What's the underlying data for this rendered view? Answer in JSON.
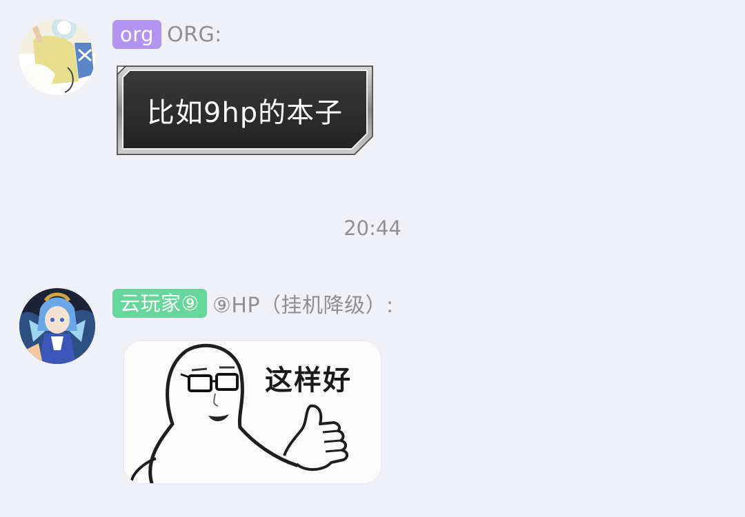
{
  "messages": [
    {
      "badge": "org",
      "sender": "ORG:",
      "text": "比如9hp的本子",
      "colors": {
        "badge": "#b394f0"
      }
    },
    {
      "badge": "云玩家⑨",
      "sender": "⑨HP（挂机降级）:",
      "sticker_caption": "这样好",
      "colors": {
        "badge": "#67d69a"
      }
    }
  ],
  "timestamp": "20:44",
  "colors": {
    "background": "#f0f1f7",
    "meta_text": "#8e8e93",
    "bubble": "#2c2c2c"
  }
}
